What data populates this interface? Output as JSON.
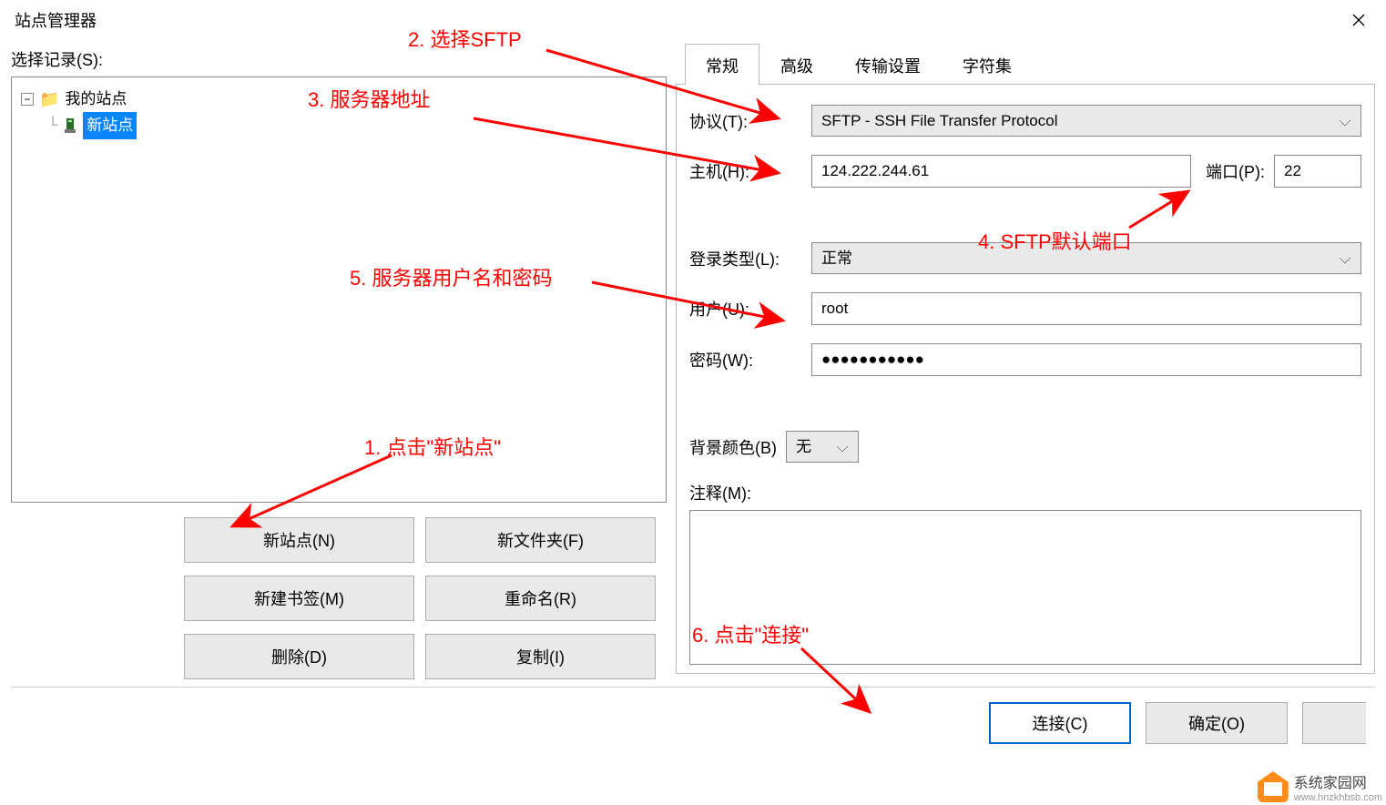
{
  "window": {
    "title": "站点管理器"
  },
  "left": {
    "select_label": "选择记录(S):",
    "root": "我的站点",
    "new_site": "新站点",
    "buttons": {
      "new_site": "新站点(N)",
      "new_folder": "新文件夹(F)",
      "new_bookmark": "新建书签(M)",
      "rename": "重命名(R)",
      "delete": "删除(D)",
      "copy": "复制(I)"
    }
  },
  "tabs": {
    "general": "常规",
    "advanced": "高级",
    "transfer": "传输设置",
    "charset": "字符集"
  },
  "fields": {
    "protocol_label": "协议(T):",
    "protocol_value": "SFTP - SSH File Transfer Protocol",
    "host_label": "主机(H):",
    "host_value": "124.222.244.61",
    "port_label": "端口(P):",
    "port_value": "22",
    "logon_label": "登录类型(L):",
    "logon_value": "正常",
    "user_label": "用户(U):",
    "user_value": "root",
    "pass_label": "密码(W):",
    "pass_value": "●●●●●●●●●●●",
    "bg_label": "背景颜色(B)",
    "bg_value": "无",
    "notes_label": "注释(M):"
  },
  "footer": {
    "connect": "连接(C)",
    "ok": "确定(O)"
  },
  "annotations": {
    "a1": "1. 点击\"新站点\"",
    "a2": "2. 选择SFTP",
    "a3": "3. 服务器地址",
    "a4": "4. SFTP默认端口",
    "a5": "5. 服务器用户名和密码",
    "a6": "6. 点击\"连接\""
  },
  "watermark": {
    "line1": "系统家园网",
    "line2": "www.hnzkhbsb.com"
  }
}
